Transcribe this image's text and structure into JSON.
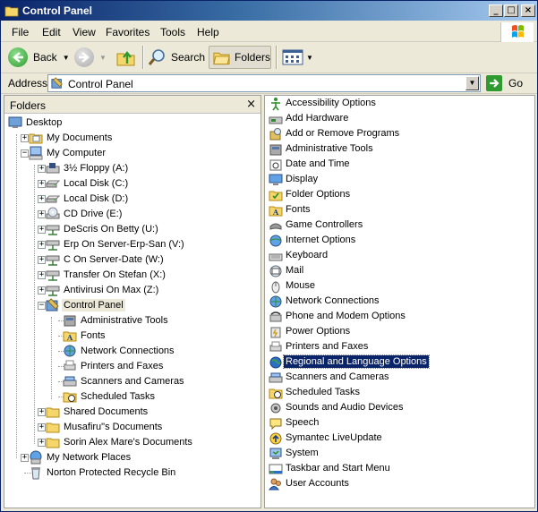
{
  "window": {
    "title": "Control Panel",
    "buttons": {
      "minimize": "_",
      "maximize": "□",
      "close": "×"
    }
  },
  "menu": [
    "File",
    "Edit",
    "View",
    "Favorites",
    "Tools",
    "Help"
  ],
  "toolbar": {
    "back": "Back",
    "search": "Search",
    "folders": "Folders"
  },
  "address": {
    "label": "Address",
    "value": "Control Panel",
    "go": "Go"
  },
  "folders_pane": {
    "title": "Folders",
    "close": "×",
    "tree": [
      {
        "label": "Desktop",
        "level": 0,
        "expander": "",
        "icon": "desktop-icon"
      },
      {
        "label": "My Documents",
        "level": 1,
        "expander": "+",
        "icon": "my-documents-icon"
      },
      {
        "label": "My Computer",
        "level": 1,
        "expander": "−",
        "icon": "my-computer-icon"
      },
      {
        "label": "3½ Floppy (A:)",
        "level": 2,
        "expander": "+",
        "icon": "floppy-drive-icon"
      },
      {
        "label": "Local Disk (C:)",
        "level": 2,
        "expander": "+",
        "icon": "local-disk-icon"
      },
      {
        "label": "Local Disk (D:)",
        "level": 2,
        "expander": "+",
        "icon": "local-disk-icon"
      },
      {
        "label": "CD Drive (E:)",
        "level": 2,
        "expander": "+",
        "icon": "cd-drive-icon"
      },
      {
        "label": "DeScris On Betty (U:)",
        "level": 2,
        "expander": "+",
        "icon": "network-drive-icon"
      },
      {
        "label": "Erp On Server-Erp-San (V:)",
        "level": 2,
        "expander": "+",
        "icon": "network-drive-icon"
      },
      {
        "label": "C On Server-Date (W:)",
        "level": 2,
        "expander": "+",
        "icon": "network-drive-icon"
      },
      {
        "label": "Transfer On Stefan (X:)",
        "level": 2,
        "expander": "+",
        "icon": "network-drive-icon"
      },
      {
        "label": "Antivirusi On Max (Z:)",
        "level": 2,
        "expander": "+",
        "icon": "network-drive-icon"
      },
      {
        "label": "Control Panel",
        "level": 2,
        "expander": "−",
        "icon": "control-panel-icon",
        "selected": true
      },
      {
        "label": "Administrative Tools",
        "level": 3,
        "expander": "",
        "icon": "administrative-tools-icon"
      },
      {
        "label": "Fonts",
        "level": 3,
        "expander": "",
        "icon": "fonts-folder-icon"
      },
      {
        "label": "Network Connections",
        "level": 3,
        "expander": "",
        "icon": "network-connections-icon"
      },
      {
        "label": "Printers and Faxes",
        "level": 3,
        "expander": "",
        "icon": "printers-icon"
      },
      {
        "label": "Scanners and Cameras",
        "level": 3,
        "expander": "",
        "icon": "scanners-icon"
      },
      {
        "label": "Scheduled Tasks",
        "level": 3,
        "expander": "",
        "icon": "scheduled-tasks-icon"
      },
      {
        "label": "Shared Documents",
        "level": 2,
        "expander": "+",
        "icon": "folder-icon"
      },
      {
        "label": "Musafiru\"s Documents",
        "level": 2,
        "expander": "+",
        "icon": "folder-icon"
      },
      {
        "label": "Sorin Alex Mare's Documents",
        "level": 2,
        "expander": "+",
        "icon": "folder-icon"
      },
      {
        "label": "My Network Places",
        "level": 1,
        "expander": "+",
        "icon": "network-places-icon"
      },
      {
        "label": "Norton Protected Recycle Bin",
        "level": 1,
        "expander": "",
        "icon": "recycle-bin-icon"
      }
    ]
  },
  "control_panel_items": [
    {
      "label": "Accessibility Options",
      "icon": "accessibility-icon"
    },
    {
      "label": "Add Hardware",
      "icon": "add-hardware-icon"
    },
    {
      "label": "Add or Remove Programs",
      "icon": "add-remove-programs-icon"
    },
    {
      "label": "Administrative Tools",
      "icon": "administrative-tools-icon"
    },
    {
      "label": "Date and Time",
      "icon": "date-time-icon"
    },
    {
      "label": "Display",
      "icon": "display-icon"
    },
    {
      "label": "Folder Options",
      "icon": "folder-options-icon"
    },
    {
      "label": "Fonts",
      "icon": "fonts-folder-icon"
    },
    {
      "label": "Game Controllers",
      "icon": "game-controllers-icon"
    },
    {
      "label": "Internet Options",
      "icon": "internet-options-icon"
    },
    {
      "label": "Keyboard",
      "icon": "keyboard-icon"
    },
    {
      "label": "Mail",
      "icon": "mail-icon"
    },
    {
      "label": "Mouse",
      "icon": "mouse-icon"
    },
    {
      "label": "Network Connections",
      "icon": "network-connections-icon"
    },
    {
      "label": "Phone and Modem Options",
      "icon": "phone-modem-icon"
    },
    {
      "label": "Power Options",
      "icon": "power-options-icon"
    },
    {
      "label": "Printers and Faxes",
      "icon": "printers-icon"
    },
    {
      "label": "Regional and Language Options",
      "icon": "regional-language-icon",
      "selected": true
    },
    {
      "label": "Scanners and Cameras",
      "icon": "scanners-icon"
    },
    {
      "label": "Scheduled Tasks",
      "icon": "scheduled-tasks-icon"
    },
    {
      "label": "Sounds and Audio Devices",
      "icon": "sounds-audio-icon"
    },
    {
      "label": "Speech",
      "icon": "speech-icon"
    },
    {
      "label": "Symantec LiveUpdate",
      "icon": "liveupdate-icon"
    },
    {
      "label": "System",
      "icon": "system-icon"
    },
    {
      "label": "Taskbar and Start Menu",
      "icon": "taskbar-icon"
    },
    {
      "label": "User Accounts",
      "icon": "user-accounts-icon"
    }
  ],
  "colors": {
    "selection": "#0a246a",
    "titlebar_start": "#0a246a",
    "titlebar_end": "#a6caf0",
    "chrome": "#ece9d8"
  }
}
